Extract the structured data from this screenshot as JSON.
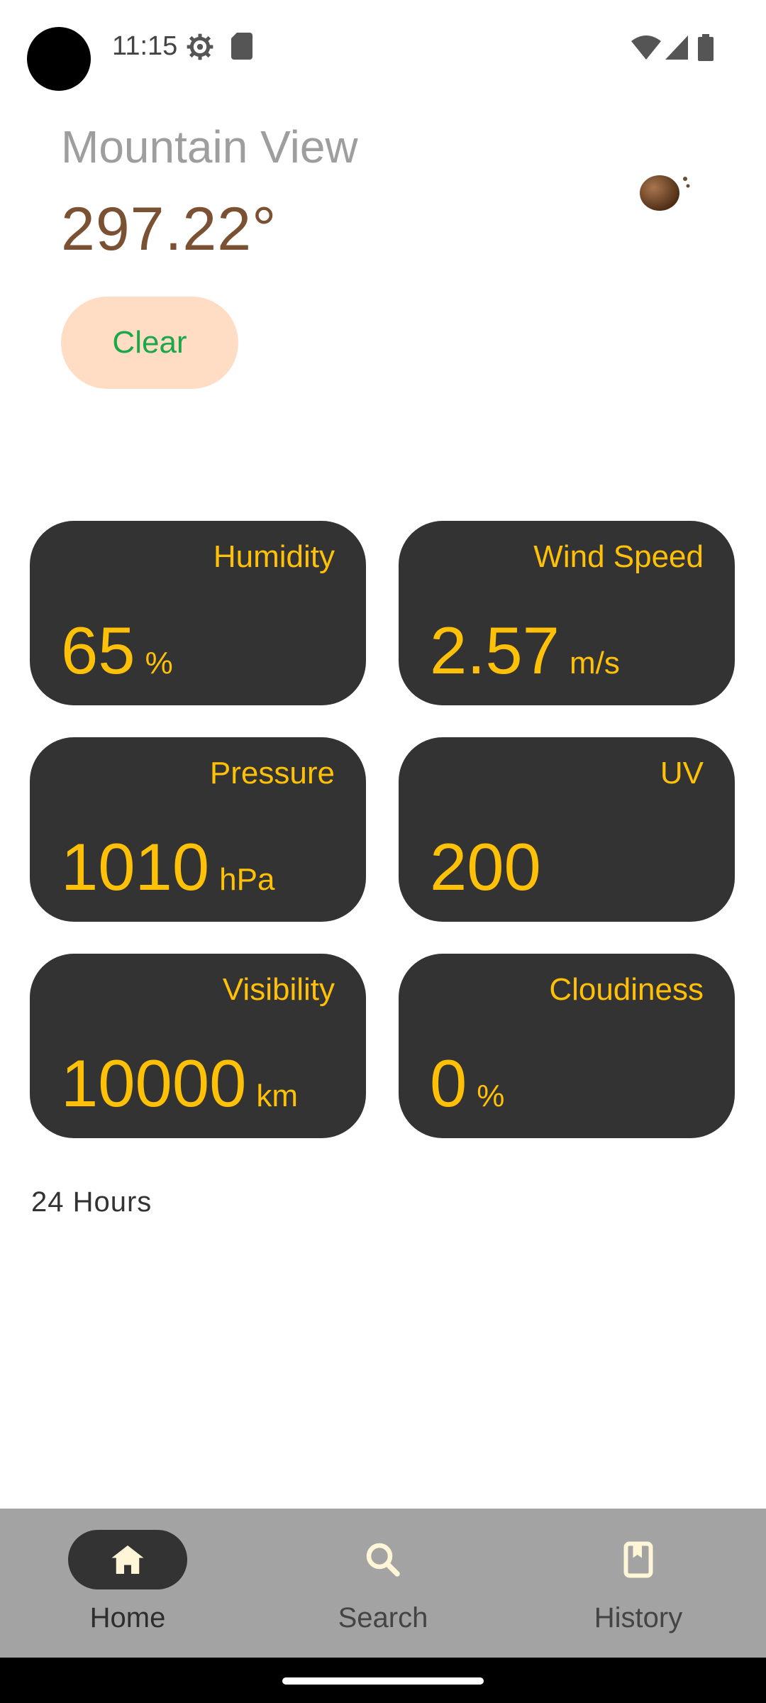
{
  "status_bar": {
    "time": "11:15",
    "icons": [
      "settings-gear-icon",
      "sd-card-icon",
      "wifi-icon",
      "signal-icon",
      "battery-icon"
    ]
  },
  "header": {
    "city": "Mountain View",
    "temperature": "297.22°",
    "condition_button": "Clear",
    "weather_icon": "clear-weather-icon"
  },
  "cards": [
    {
      "label": "Humidity",
      "value": "65",
      "unit": "%"
    },
    {
      "label": "Wind Speed",
      "value": "2.57",
      "unit": "m/s"
    },
    {
      "label": "Pressure",
      "value": "1010",
      "unit": "hPa"
    },
    {
      "label": "UV",
      "value": "200",
      "unit": ""
    },
    {
      "label": "Visibility",
      "value": "10000",
      "unit": "km"
    },
    {
      "label": "Cloudiness",
      "value": "0",
      "unit": "%"
    }
  ],
  "section": {
    "hours_title": "24 Hours"
  },
  "bottom_nav": {
    "items": [
      {
        "label": "Home",
        "icon": "home-icon",
        "active": true
      },
      {
        "label": "Search",
        "icon": "search-icon",
        "active": false
      },
      {
        "label": "History",
        "icon": "bookmark-icon",
        "active": false
      }
    ]
  },
  "colors": {
    "card_bg": "#333333",
    "card_text": "#ffc107",
    "temp_text": "#7a5132",
    "clear_button_bg": "#ffdcc4",
    "clear_button_text": "#1aa84a",
    "nav_bg": "#a3a3a3"
  }
}
